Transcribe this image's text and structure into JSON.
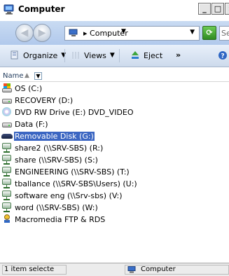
{
  "window": {
    "title": "Computer",
    "min_glyph": "_",
    "max_glyph": "□",
    "close_glyph": "×"
  },
  "address_bar": {
    "breadcrumb": "Computer",
    "search_placeholder": "Se"
  },
  "toolbar": {
    "organize_label": "Organize",
    "views_label": "Views",
    "eject_label": "Eject",
    "more_label": "»"
  },
  "columns": {
    "name_label": "Name"
  },
  "items": [
    {
      "label": "OS (C:)",
      "icon": "os-drive-icon"
    },
    {
      "label": "RECOVERY (D:)",
      "icon": "hard-drive-icon"
    },
    {
      "label": "DVD RW Drive (E:) DVD_VIDEO",
      "icon": "dvd-drive-icon"
    },
    {
      "label": "Data (F:)",
      "icon": "hard-drive-icon"
    },
    {
      "label": "Removable Disk (G:)",
      "icon": "removable-disk-icon",
      "selected": true
    },
    {
      "label": "share2 (\\\\SRV-SBS) (R:)",
      "icon": "network-drive-icon"
    },
    {
      "label": "share (\\\\SRV-SBS) (S:)",
      "icon": "network-drive-icon"
    },
    {
      "label": "ENGINEERING (\\\\SRV-SBS) (T:)",
      "icon": "network-drive-icon"
    },
    {
      "label": "tballance (\\\\SRV-SBS\\Users) (U:)",
      "icon": "network-drive-icon"
    },
    {
      "label": "software eng (\\\\Srv-sbs) (V:)",
      "icon": "network-drive-icon"
    },
    {
      "label": "word (\\\\SRV-SBS) (W:)",
      "icon": "network-drive-icon"
    },
    {
      "label": "Macromedia FTP & RDS",
      "icon": "ftp-icon"
    }
  ],
  "status_bar": {
    "selection_text": "1 item selecte",
    "location_text": "Computer"
  },
  "colors": {
    "selection": "#3b66c2",
    "address_bg": "#c1d5ef",
    "toolbar_bg": "#dde7f5"
  }
}
